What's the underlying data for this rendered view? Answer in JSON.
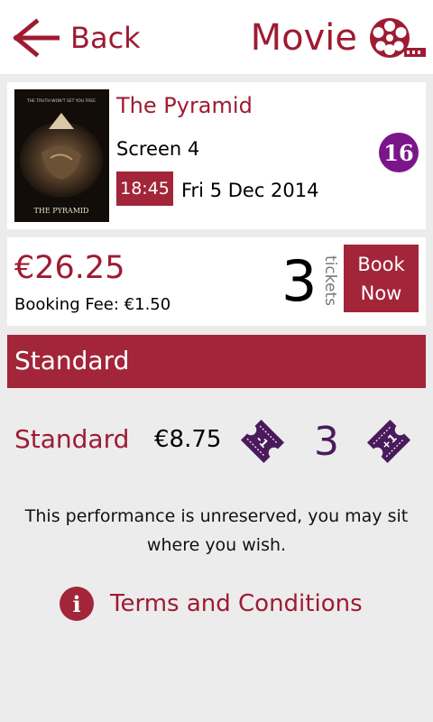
{
  "header": {
    "back_label": "Back",
    "title": "Movie",
    "icons": {
      "back": "arrow-left-icon",
      "brand": "film-reel-icon"
    }
  },
  "movie": {
    "title": "The Pyramid",
    "screen": "Screen 4",
    "rating": "16",
    "time": "18:45",
    "date": "Fri 5 Dec 2014",
    "poster_caption": "THE PYRAMID",
    "poster_tagline": "THE TRUTH WON'T SET YOU FREE"
  },
  "booking": {
    "total_price": "€26.25",
    "booking_fee": "Booking Fee: €1.50",
    "ticket_count": "3",
    "tickets_label": "tickets",
    "book_line1": "Book",
    "book_line2": "Now"
  },
  "section": {
    "title": "Standard"
  },
  "ticket_row": {
    "type": "Standard",
    "price": "€8.75",
    "quantity": "3",
    "minus_label": "-1",
    "plus_label": "+1"
  },
  "notice": "This performance is unreserved, you may sit where you wish.",
  "terms": {
    "label": "Terms and Conditions",
    "icon_glyph": "i"
  },
  "colors": {
    "accent": "#a3253a",
    "accent_text": "#9e1b32",
    "rating": "#7a1688",
    "quantity": "#4a1b5c",
    "ticket_icon": "#4a1b5c"
  }
}
